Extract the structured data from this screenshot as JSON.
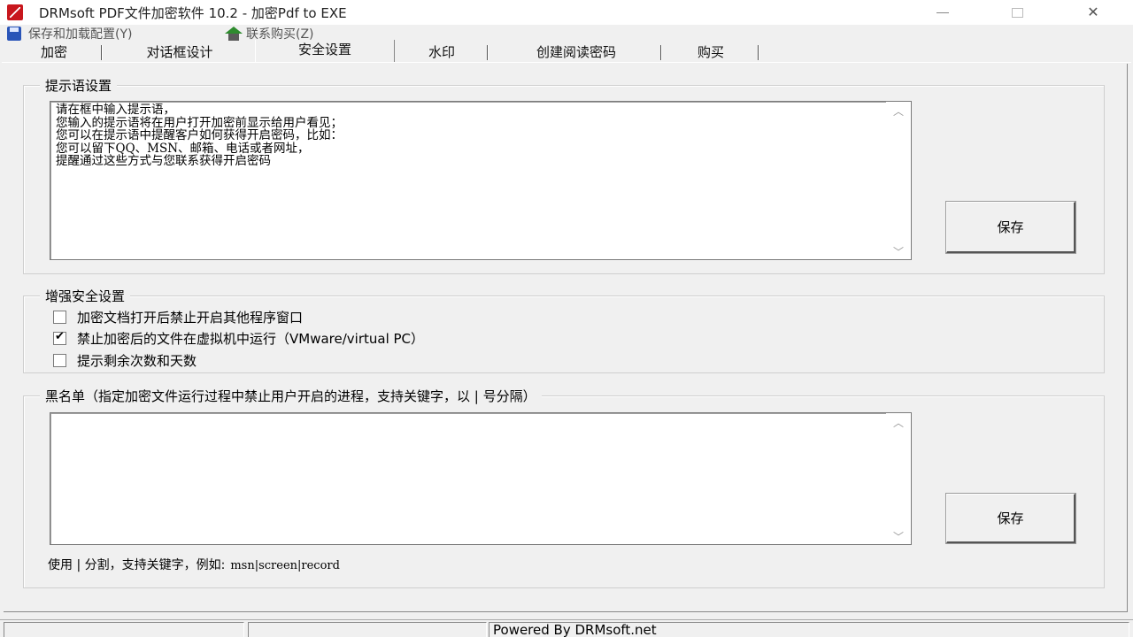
{
  "window": {
    "title": "DRMsoft PDF文件加密软件 10.2 - 加密Pdf to EXE",
    "minimize": "—",
    "close": "✕"
  },
  "menu": {
    "items": [
      {
        "label": "保存和加载配置(Y)",
        "icon": "save-icon"
      },
      {
        "label": "联系购买(Z)",
        "icon": "house-icon"
      }
    ]
  },
  "tabs": [
    {
      "label": "加密",
      "active": false
    },
    {
      "label": "对话框设计",
      "active": false
    },
    {
      "label": "安全设置",
      "active": true
    },
    {
      "label": "水印",
      "active": false
    },
    {
      "label": "创建阅读密码",
      "active": false
    },
    {
      "label": "购买",
      "active": false
    }
  ],
  "prompt_group": {
    "title": "提示语设置",
    "text": "请在框中输入提示语，\n您输入的提示语将在用户打开加密前显示给用户看见；\n您可以在提示语中提醒客户如何获得开启密码，比如：\n您可以留下QQ、MSN、邮箱、电话或者网址，\n提醒通过这些方式与您联系获得开启密码",
    "save_label": "保存"
  },
  "security_group": {
    "title": "增强安全设置",
    "options": [
      {
        "label": "加密文档打开后禁止开启其他程序窗口",
        "checked": false
      },
      {
        "label": "禁止加密后的文件在虚拟机中运行（VMware/virtual PC）",
        "checked": true
      },
      {
        "label": "提示剩余次数和天数",
        "checked": false
      }
    ]
  },
  "blacklist_group": {
    "title": "黑名单（指定加密文件运行过程中禁止用户开启的进程，支持关键字，以 | 号分隔）",
    "text": "",
    "save_label": "保存",
    "hint_text": "使用 | 分割，支持关键字，例如:",
    "hint_example": "msn|screen|record"
  },
  "status": {
    "powered_by": "Powered By DRMsoft.net"
  }
}
